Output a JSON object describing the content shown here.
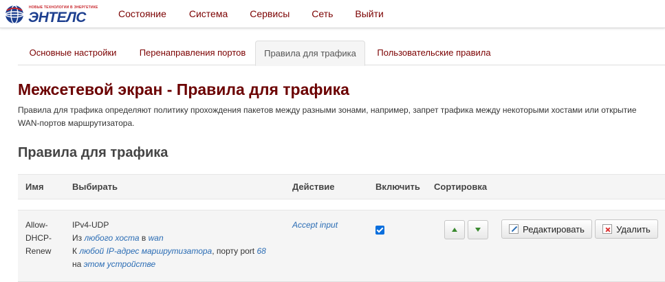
{
  "brand": {
    "tagline": "НОВЫЕ ТЕХНОЛОГИИ В ЭНЕРГЕТИКЕ",
    "name": "ЭНТЕЛС"
  },
  "topnav": [
    "Состояние",
    "Система",
    "Сервисы",
    "Сеть",
    "Выйти"
  ],
  "tabs": [
    {
      "label": "Основные настройки",
      "active": false
    },
    {
      "label": "Перенаправления портов",
      "active": false
    },
    {
      "label": "Правила для трафика",
      "active": true
    },
    {
      "label": "Пользовательские правила",
      "active": false
    }
  ],
  "page": {
    "title": "Межсетевой экран - Правила для трафика",
    "description": "Правила для трафика определяют политику прохождения пакетов между разными зонами, например, запрет трафика между некоторыми хостами или открытие WAN-портов маршрутизатора."
  },
  "section": {
    "title": "Правила для трафика",
    "columns": [
      "Имя",
      "Выбирать",
      "Действие",
      "Включить",
      "Сортировка"
    ]
  },
  "rules": [
    {
      "name_lines": [
        "Allow-",
        "DHCP-",
        "Renew"
      ],
      "match": {
        "proto": "IPv4-UDP",
        "from_prefix": "Из",
        "from_host": "любого хоста",
        "in_word": "в",
        "from_zone": "wan",
        "to_prefix": "К",
        "to_host": "любой IP-адрес маршрутизатора",
        "port_text": ", порту port",
        "port": "68",
        "on_word": "на",
        "device": "этом устройстве"
      },
      "action": "Accept input",
      "enabled": true,
      "edit_label": "Редактировать",
      "delete_label": "Удалить"
    }
  ],
  "colors": {
    "nav_link": "#7b0000",
    "title": "#6b0000",
    "link": "#2a6cb4",
    "checkbox": "#0b6fdd"
  }
}
